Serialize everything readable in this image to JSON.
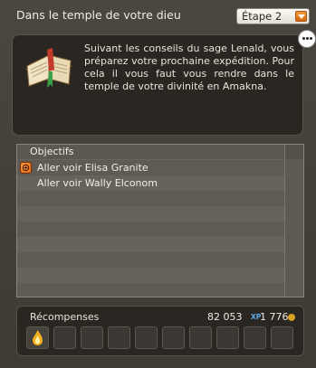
{
  "window": {
    "title": "Dans le temple de votre dieu",
    "step_select": {
      "value": "Étape 2"
    }
  },
  "description": {
    "text": "Suivant les conseils du sage Lenald, vous préparez votre prochaine expédition. Pour cela il vous faut vous rendre dans le temple de votre divinité en Amakna."
  },
  "objectives": {
    "header": "Objectifs",
    "items": [
      {
        "label": "Aller voir Elisa Granite",
        "icon": "quest-marker-icon"
      },
      {
        "label": "Aller voir Wally Elconom",
        "icon": ""
      }
    ]
  },
  "rewards": {
    "header": "Récompenses",
    "xp_value": "82 053",
    "xp_unit": "XP",
    "kamas_value": "1 776",
    "kamas_icon": "kama-coin-icon",
    "slots": [
      {
        "icon": "flame-orb-icon"
      },
      {
        "icon": ""
      },
      {
        "icon": ""
      },
      {
        "icon": ""
      },
      {
        "icon": ""
      },
      {
        "icon": ""
      },
      {
        "icon": ""
      },
      {
        "icon": ""
      },
      {
        "icon": ""
      },
      {
        "icon": ""
      }
    ]
  },
  "colors": {
    "accent": "#e57a1c",
    "xp": "#5ea8e8",
    "kama": "#d8a020"
  }
}
